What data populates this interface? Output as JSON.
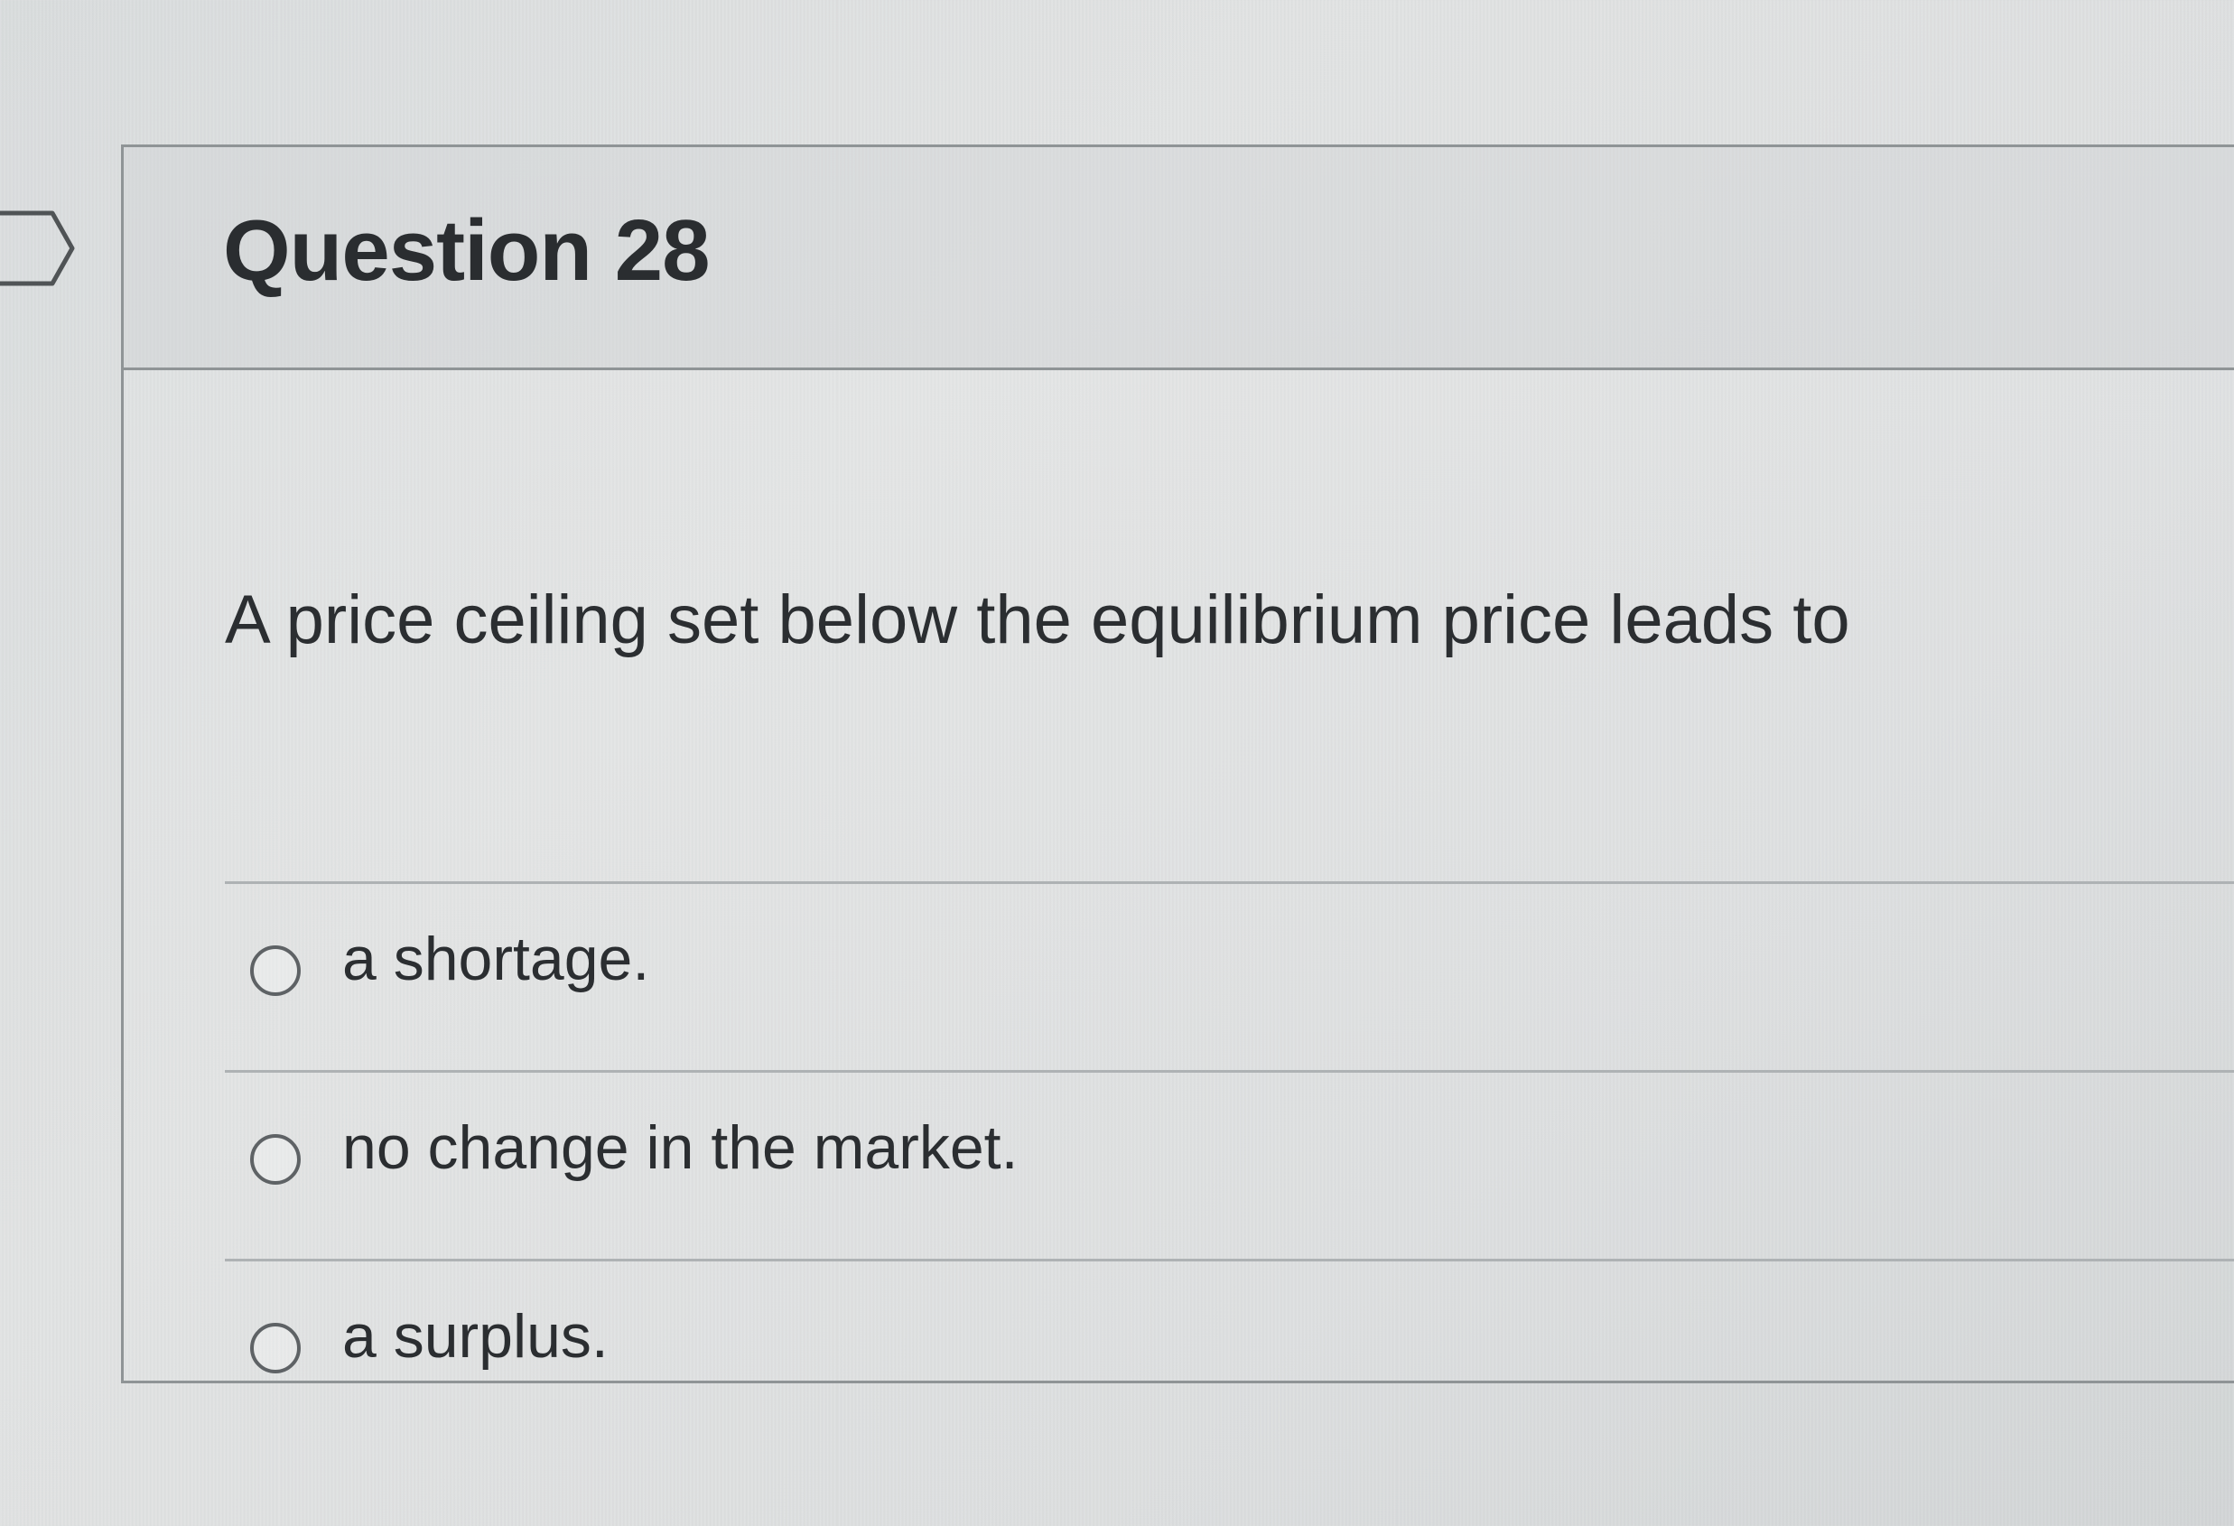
{
  "question": {
    "title": "Question 28",
    "prompt": "A price ceiling set below the equilibrium price leads to",
    "options": [
      {
        "label": "a shortage.",
        "selected": false
      },
      {
        "label": "no change in the market.",
        "selected": false
      },
      {
        "label": "a surplus.",
        "selected": false
      }
    ]
  },
  "icons": {
    "flag": "flag-marker-icon",
    "radio": "radio-unchecked-icon"
  },
  "colors": {
    "border": "#8f9496",
    "divider": "#aeb2b4",
    "text": "#2b2e31",
    "radio": "#5e6265"
  }
}
